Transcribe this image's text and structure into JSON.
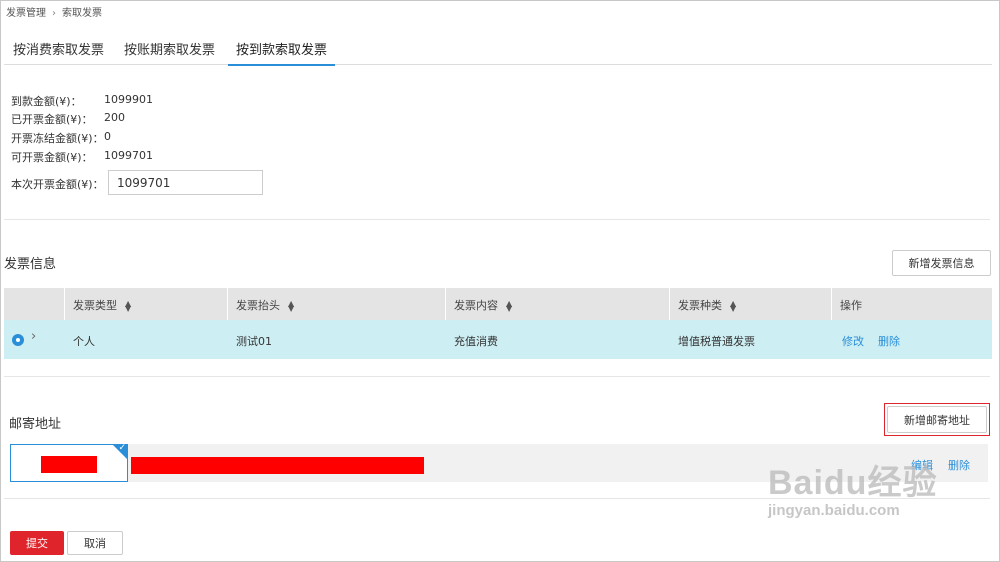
{
  "breadcrumb": {
    "parent": "发票管理",
    "separator": "›",
    "current": "索取发票"
  },
  "tabs": [
    {
      "label": "按消费索取发票",
      "active": false
    },
    {
      "label": "按账期索取发票",
      "active": false
    },
    {
      "label": "按到款索取发票",
      "active": true
    }
  ],
  "summary": {
    "received_label": "到款金额(¥)：",
    "received_value": "1099901",
    "invoiced_label": "已开票金额(¥)：",
    "invoiced_value": "200",
    "frozen_label": "开票冻结金额(¥)：",
    "frozen_value": "0",
    "available_label": "可开票金额(¥)：",
    "available_value": "1099701",
    "current_label": "本次开票金额(¥)：",
    "current_value": "1099701"
  },
  "invoice_info": {
    "title": "发票信息",
    "add_button": "新增发票信息",
    "columns": [
      "发票类型",
      "发票抬头",
      "发票内容",
      "发票种类",
      "操作"
    ],
    "rows": [
      {
        "type": "个人",
        "header": "测试01",
        "content": "充值消费",
        "kind": "增值税普通发票",
        "edit": "修改",
        "delete": "删除"
      }
    ]
  },
  "mailing": {
    "title": "邮寄地址",
    "add_button": "新增邮寄地址",
    "edit": "编辑",
    "delete": "删除"
  },
  "actions": {
    "submit": "提交",
    "cancel": "取消"
  },
  "watermark": {
    "main": "Baidu经验",
    "sub": "jingyan.baidu.com"
  },
  "colors": {
    "accent": "#2a8fd8",
    "danger": "#e0242b",
    "row_selected": "#cdeef3",
    "redaction": "#ff0000"
  }
}
